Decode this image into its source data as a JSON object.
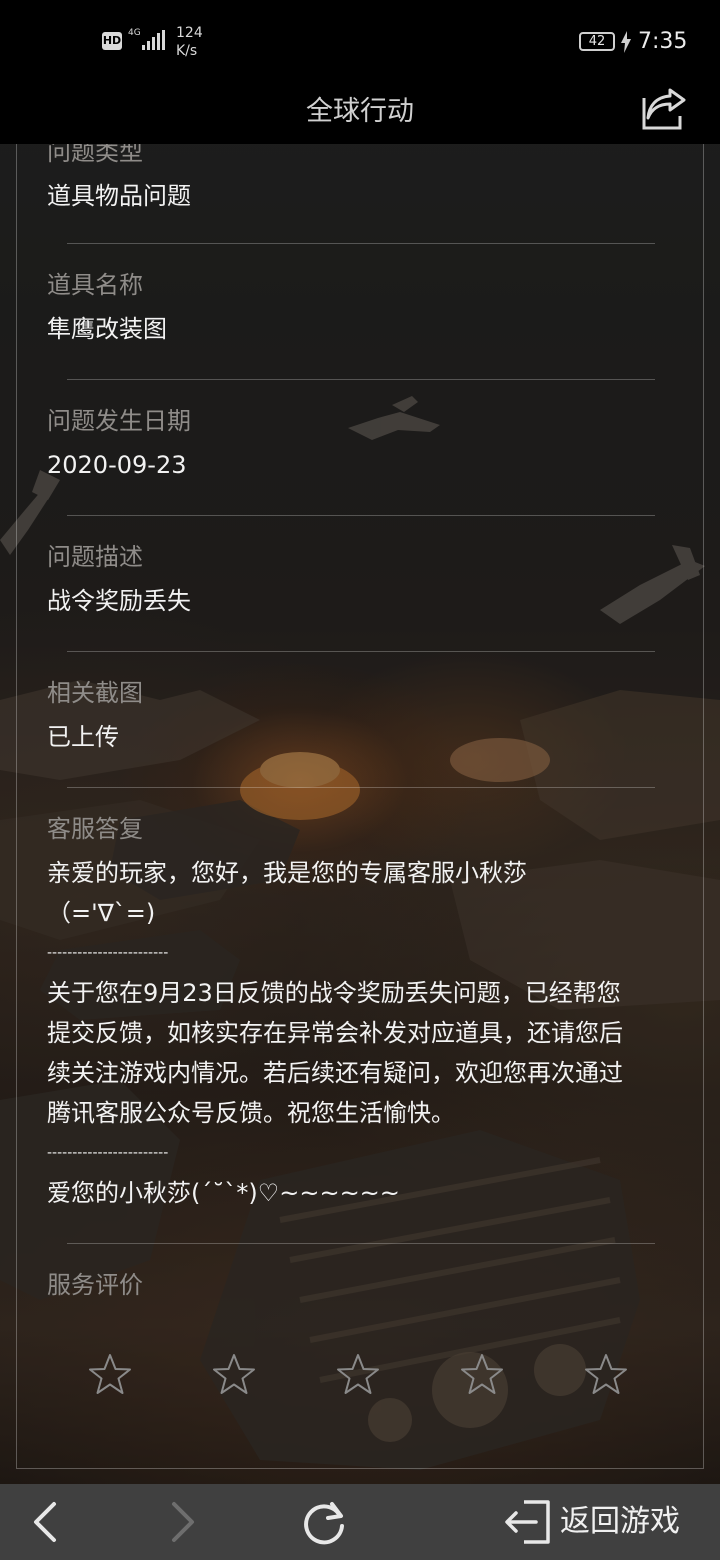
{
  "status_bar": {
    "hd": "HD",
    "network": "4G",
    "speed_value": "124",
    "speed_unit": "K/s",
    "battery": "42",
    "time": "7:35"
  },
  "header": {
    "title": "全球行动",
    "share_icon": "share-icon"
  },
  "fields": [
    {
      "label": "问题类型",
      "value": "道具物品问题"
    },
    {
      "label": "道具名称",
      "value": "隼鹰改装图"
    },
    {
      "label": "问题发生日期",
      "value": "2020-09-23"
    },
    {
      "label": "问题描述",
      "value": "战令奖励丢失"
    },
    {
      "label": "相关截图",
      "value": "已上传"
    }
  ],
  "reply": {
    "label": "客服答复",
    "lines": [
      "亲爱的玩家，您好，我是您的专属客服小秋莎",
      "（='∇`=)",
      "------------------------",
      "关于您在9月23日反馈的战令奖励丢失问题，已经帮您",
      "提交反馈，如核实存在异常会补发对应道具，还请您后",
      "续关注游戏内情况。若后续还有疑问，欢迎您再次通过",
      "腾讯客服公众号反馈。祝您生活愉快。",
      "------------------------",
      "爱您的小秋莎(´˘`*)♡~~~~~~"
    ]
  },
  "rating": {
    "label": "服务评价",
    "stars_total": 5,
    "stars_selected": 0
  },
  "bottom_nav": {
    "back_icon": "chevron-left-icon",
    "forward_icon": "chevron-right-icon",
    "refresh_icon": "refresh-icon",
    "return_icon": "exit-icon",
    "return_label": "返回游戏"
  },
  "colors": {
    "label": "#8f8c89",
    "value": "#f2f2f2",
    "bar": "#000000",
    "bottom_nav": "#404040"
  }
}
